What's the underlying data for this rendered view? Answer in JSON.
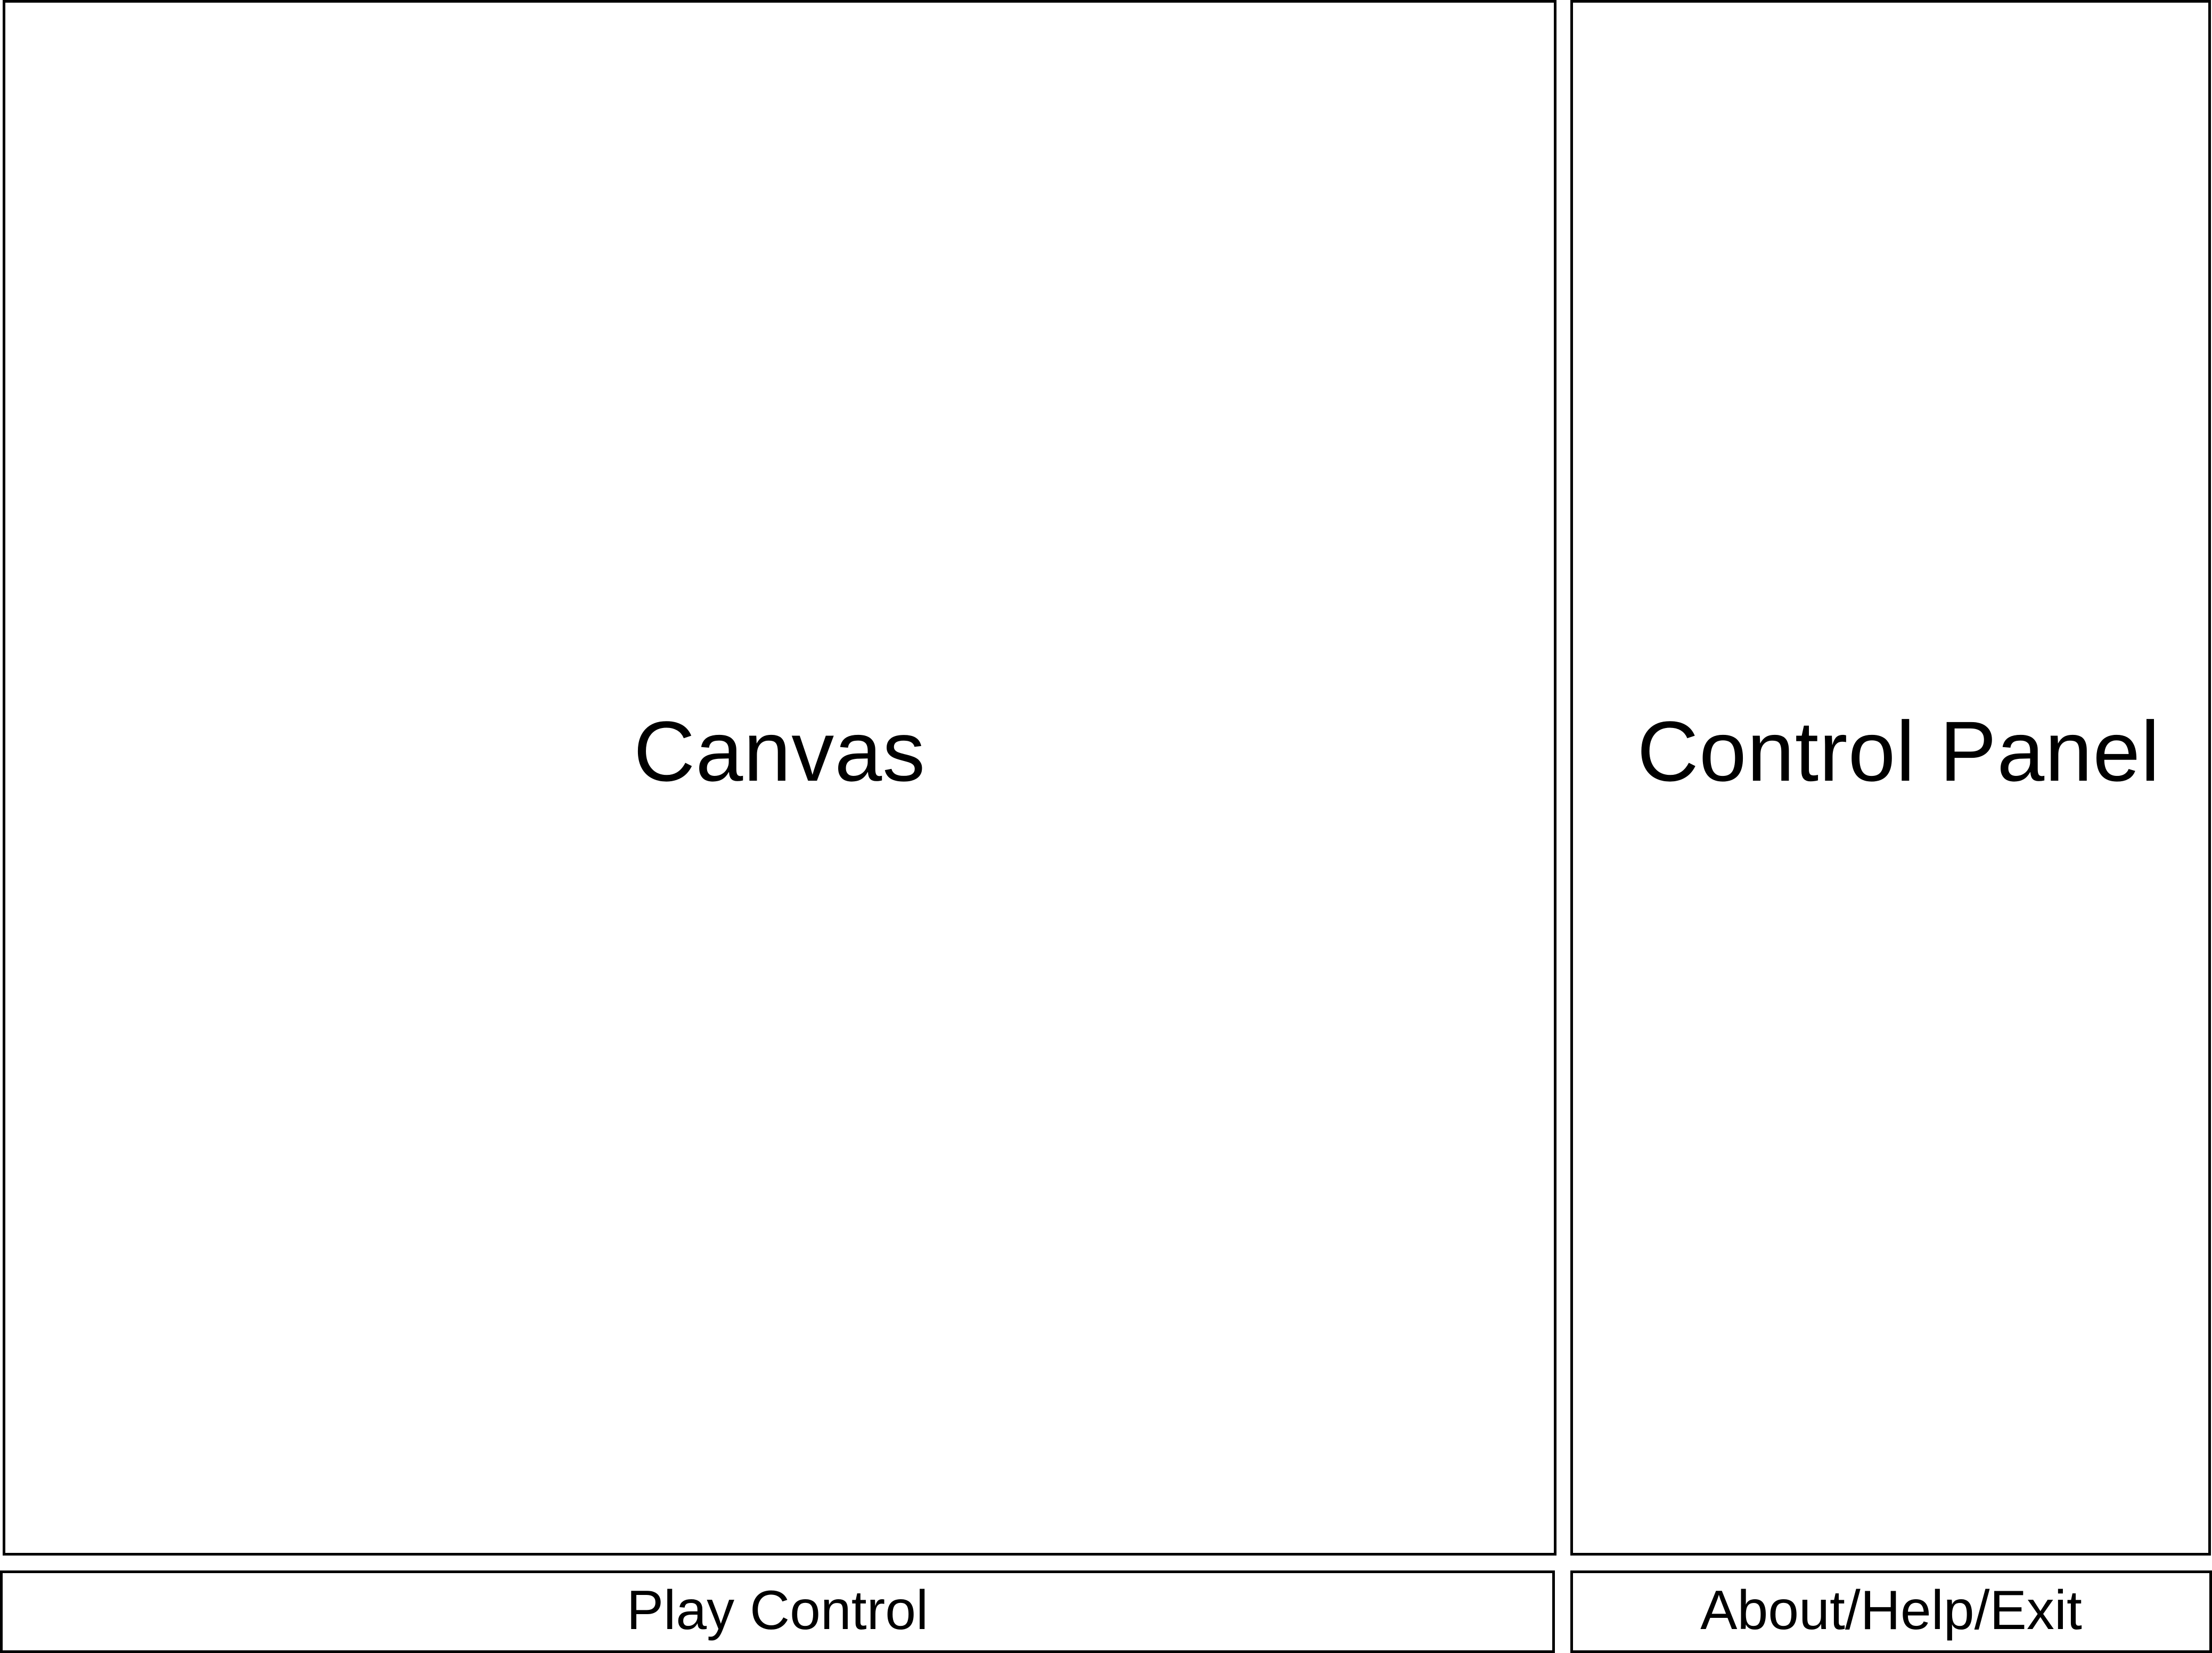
{
  "canvas": {
    "label": "Canvas"
  },
  "control_panel": {
    "label": "Control Panel"
  },
  "play_control": {
    "label": "Play Control"
  },
  "about_help_exit": {
    "label": "About/Help/Exit"
  },
  "colors": {
    "border": "#000000",
    "background": "#ffffff",
    "text": "#000000"
  }
}
